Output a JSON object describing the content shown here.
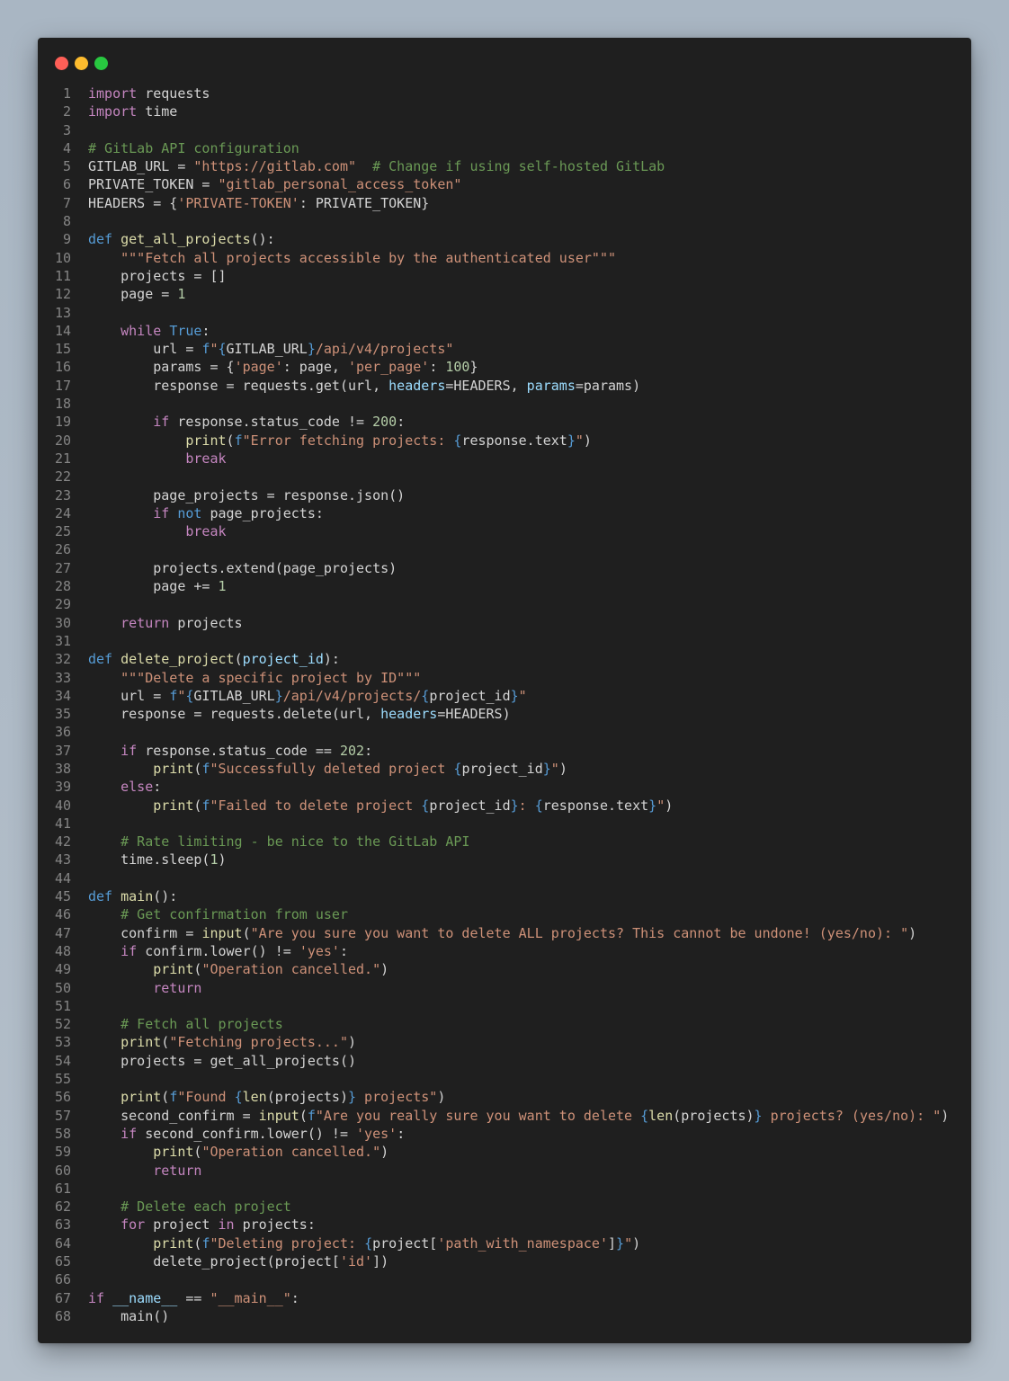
{
  "window": {
    "controls": [
      {
        "name": "close",
        "color": "#ff5f57"
      },
      {
        "name": "minimize",
        "color": "#febc2e"
      },
      {
        "name": "maximize",
        "color": "#28c840"
      }
    ]
  },
  "code": {
    "language": "python",
    "lines": [
      [
        [
          "kw",
          "import"
        ],
        [
          "tx",
          " requests"
        ]
      ],
      [
        [
          "kw",
          "import"
        ],
        [
          "tx",
          " time"
        ]
      ],
      [],
      [
        [
          "cm",
          "# GitLab API configuration"
        ]
      ],
      [
        [
          "tx",
          "GITLAB_URL = "
        ],
        [
          "str",
          "\"https://gitlab.com\""
        ],
        [
          "tx",
          "  "
        ],
        [
          "cm",
          "# Change if using self-hosted GitLab"
        ]
      ],
      [
        [
          "tx",
          "PRIVATE_TOKEN = "
        ],
        [
          "str",
          "\"gitlab_personal_access_token\""
        ]
      ],
      [
        [
          "tx",
          "HEADERS = {"
        ],
        [
          "str",
          "'PRIVATE-TOKEN'"
        ],
        [
          "tx",
          ": PRIVATE_TOKEN}"
        ]
      ],
      [],
      [
        [
          "dk",
          "def"
        ],
        [
          "tx",
          " "
        ],
        [
          "fn",
          "get_all_projects"
        ],
        [
          "tx",
          "():"
        ]
      ],
      [
        [
          "tx",
          "    "
        ],
        [
          "str",
          "\"\"\"Fetch all projects accessible by the authenticated user\"\"\""
        ]
      ],
      [
        [
          "tx",
          "    projects = []"
        ]
      ],
      [
        [
          "tx",
          "    page = "
        ],
        [
          "num",
          "1"
        ]
      ],
      [],
      [
        [
          "tx",
          "    "
        ],
        [
          "kw",
          "while"
        ],
        [
          "tx",
          " "
        ],
        [
          "dk",
          "True"
        ],
        [
          "tx",
          ":"
        ]
      ],
      [
        [
          "tx",
          "        url = "
        ],
        [
          "dk",
          "f"
        ],
        [
          "str",
          "\""
        ],
        [
          "br",
          "{"
        ],
        [
          "tx",
          "GITLAB_URL"
        ],
        [
          "br",
          "}"
        ],
        [
          "str",
          "/api/v4/projects\""
        ]
      ],
      [
        [
          "tx",
          "        params = {"
        ],
        [
          "str",
          "'page'"
        ],
        [
          "tx",
          ": page, "
        ],
        [
          "str",
          "'per_page'"
        ],
        [
          "tx",
          ": "
        ],
        [
          "num",
          "100"
        ],
        [
          "tx",
          "}"
        ]
      ],
      [
        [
          "tx",
          "        response = requests.get(url, "
        ],
        [
          "prm",
          "headers"
        ],
        [
          "tx",
          "=HEADERS, "
        ],
        [
          "prm",
          "params"
        ],
        [
          "tx",
          "=params)"
        ]
      ],
      [],
      [
        [
          "tx",
          "        "
        ],
        [
          "kw",
          "if"
        ],
        [
          "tx",
          " response.status_code != "
        ],
        [
          "num",
          "200"
        ],
        [
          "tx",
          ":"
        ]
      ],
      [
        [
          "tx",
          "            "
        ],
        [
          "fn",
          "print"
        ],
        [
          "tx",
          "("
        ],
        [
          "dk",
          "f"
        ],
        [
          "str",
          "\"Error fetching projects: "
        ],
        [
          "br",
          "{"
        ],
        [
          "tx",
          "response.text"
        ],
        [
          "br",
          "}"
        ],
        [
          "str",
          "\""
        ],
        [
          "tx",
          ")"
        ]
      ],
      [
        [
          "tx",
          "            "
        ],
        [
          "kw",
          "break"
        ]
      ],
      [],
      [
        [
          "tx",
          "        page_projects = response.json()"
        ]
      ],
      [
        [
          "tx",
          "        "
        ],
        [
          "kw",
          "if"
        ],
        [
          "tx",
          " "
        ],
        [
          "dk",
          "not"
        ],
        [
          "tx",
          " page_projects:"
        ]
      ],
      [
        [
          "tx",
          "            "
        ],
        [
          "kw",
          "break"
        ]
      ],
      [],
      [
        [
          "tx",
          "        projects.extend(page_projects)"
        ]
      ],
      [
        [
          "tx",
          "        page += "
        ],
        [
          "num",
          "1"
        ]
      ],
      [],
      [
        [
          "tx",
          "    "
        ],
        [
          "kw",
          "return"
        ],
        [
          "tx",
          " projects"
        ]
      ],
      [],
      [
        [
          "dk",
          "def"
        ],
        [
          "tx",
          " "
        ],
        [
          "fn",
          "delete_project"
        ],
        [
          "tx",
          "("
        ],
        [
          "prm",
          "project_id"
        ],
        [
          "tx",
          "):"
        ]
      ],
      [
        [
          "tx",
          "    "
        ],
        [
          "str",
          "\"\"\"Delete a specific project by ID\"\"\""
        ]
      ],
      [
        [
          "tx",
          "    url = "
        ],
        [
          "dk",
          "f"
        ],
        [
          "str",
          "\""
        ],
        [
          "br",
          "{"
        ],
        [
          "tx",
          "GITLAB_URL"
        ],
        [
          "br",
          "}"
        ],
        [
          "str",
          "/api/v4/projects/"
        ],
        [
          "br",
          "{"
        ],
        [
          "tx",
          "project_id"
        ],
        [
          "br",
          "}"
        ],
        [
          "str",
          "\""
        ]
      ],
      [
        [
          "tx",
          "    response = requests.delete(url, "
        ],
        [
          "prm",
          "headers"
        ],
        [
          "tx",
          "=HEADERS)"
        ]
      ],
      [],
      [
        [
          "tx",
          "    "
        ],
        [
          "kw",
          "if"
        ],
        [
          "tx",
          " response.status_code == "
        ],
        [
          "num",
          "202"
        ],
        [
          "tx",
          ":"
        ]
      ],
      [
        [
          "tx",
          "        "
        ],
        [
          "fn",
          "print"
        ],
        [
          "tx",
          "("
        ],
        [
          "dk",
          "f"
        ],
        [
          "str",
          "\"Successfully deleted project "
        ],
        [
          "br",
          "{"
        ],
        [
          "tx",
          "project_id"
        ],
        [
          "br",
          "}"
        ],
        [
          "str",
          "\""
        ],
        [
          "tx",
          ")"
        ]
      ],
      [
        [
          "tx",
          "    "
        ],
        [
          "kw",
          "else"
        ],
        [
          "tx",
          ":"
        ]
      ],
      [
        [
          "tx",
          "        "
        ],
        [
          "fn",
          "print"
        ],
        [
          "tx",
          "("
        ],
        [
          "dk",
          "f"
        ],
        [
          "str",
          "\"Failed to delete project "
        ],
        [
          "br",
          "{"
        ],
        [
          "tx",
          "project_id"
        ],
        [
          "br",
          "}"
        ],
        [
          "str",
          ": "
        ],
        [
          "br",
          "{"
        ],
        [
          "tx",
          "response.text"
        ],
        [
          "br",
          "}"
        ],
        [
          "str",
          "\""
        ],
        [
          "tx",
          ")"
        ]
      ],
      [],
      [
        [
          "tx",
          "    "
        ],
        [
          "cm",
          "# Rate limiting - be nice to the GitLab API"
        ]
      ],
      [
        [
          "tx",
          "    time.sleep("
        ],
        [
          "num",
          "1"
        ],
        [
          "tx",
          ")"
        ]
      ],
      [],
      [
        [
          "dk",
          "def"
        ],
        [
          "tx",
          " "
        ],
        [
          "fn",
          "main"
        ],
        [
          "tx",
          "():"
        ]
      ],
      [
        [
          "tx",
          "    "
        ],
        [
          "cm",
          "# Get confirmation from user"
        ]
      ],
      [
        [
          "tx",
          "    confirm = "
        ],
        [
          "fn",
          "input"
        ],
        [
          "tx",
          "("
        ],
        [
          "str",
          "\"Are you sure you want to delete ALL projects? This cannot be undone! (yes/no): \""
        ],
        [
          "tx",
          ")"
        ]
      ],
      [
        [
          "tx",
          "    "
        ],
        [
          "kw",
          "if"
        ],
        [
          "tx",
          " confirm.lower() != "
        ],
        [
          "str",
          "'yes'"
        ],
        [
          "tx",
          ":"
        ]
      ],
      [
        [
          "tx",
          "        "
        ],
        [
          "fn",
          "print"
        ],
        [
          "tx",
          "("
        ],
        [
          "str",
          "\"Operation cancelled.\""
        ],
        [
          "tx",
          ")"
        ]
      ],
      [
        [
          "tx",
          "        "
        ],
        [
          "kw",
          "return"
        ]
      ],
      [],
      [
        [
          "tx",
          "    "
        ],
        [
          "cm",
          "# Fetch all projects"
        ]
      ],
      [
        [
          "tx",
          "    "
        ],
        [
          "fn",
          "print"
        ],
        [
          "tx",
          "("
        ],
        [
          "str",
          "\"Fetching projects...\""
        ],
        [
          "tx",
          ")"
        ]
      ],
      [
        [
          "tx",
          "    projects = get_all_projects()"
        ]
      ],
      [],
      [
        [
          "tx",
          "    "
        ],
        [
          "fn",
          "print"
        ],
        [
          "tx",
          "("
        ],
        [
          "dk",
          "f"
        ],
        [
          "str",
          "\"Found "
        ],
        [
          "br",
          "{"
        ],
        [
          "fn",
          "len"
        ],
        [
          "tx",
          "(projects)"
        ],
        [
          "br",
          "}"
        ],
        [
          "str",
          " projects\""
        ],
        [
          "tx",
          ")"
        ]
      ],
      [
        [
          "tx",
          "    second_confirm = "
        ],
        [
          "fn",
          "input"
        ],
        [
          "tx",
          "("
        ],
        [
          "dk",
          "f"
        ],
        [
          "str",
          "\"Are you really sure you want to delete "
        ],
        [
          "br",
          "{"
        ],
        [
          "fn",
          "len"
        ],
        [
          "tx",
          "(projects)"
        ],
        [
          "br",
          "}"
        ],
        [
          "str",
          " projects? (yes/no): \""
        ],
        [
          "tx",
          ")"
        ]
      ],
      [
        [
          "tx",
          "    "
        ],
        [
          "kw",
          "if"
        ],
        [
          "tx",
          " second_confirm.lower() != "
        ],
        [
          "str",
          "'yes'"
        ],
        [
          "tx",
          ":"
        ]
      ],
      [
        [
          "tx",
          "        "
        ],
        [
          "fn",
          "print"
        ],
        [
          "tx",
          "("
        ],
        [
          "str",
          "\"Operation cancelled.\""
        ],
        [
          "tx",
          ")"
        ]
      ],
      [
        [
          "tx",
          "        "
        ],
        [
          "kw",
          "return"
        ]
      ],
      [],
      [
        [
          "tx",
          "    "
        ],
        [
          "cm",
          "# Delete each project"
        ]
      ],
      [
        [
          "tx",
          "    "
        ],
        [
          "kw",
          "for"
        ],
        [
          "tx",
          " project "
        ],
        [
          "kw",
          "in"
        ],
        [
          "tx",
          " projects:"
        ]
      ],
      [
        [
          "tx",
          "        "
        ],
        [
          "fn",
          "print"
        ],
        [
          "tx",
          "("
        ],
        [
          "dk",
          "f"
        ],
        [
          "str",
          "\"Deleting project: "
        ],
        [
          "br",
          "{"
        ],
        [
          "tx",
          "project["
        ],
        [
          "str",
          "'path_with_namespace'"
        ],
        [
          "tx",
          "]"
        ],
        [
          "br",
          "}"
        ],
        [
          "str",
          "\""
        ],
        [
          "tx",
          ")"
        ]
      ],
      [
        [
          "tx",
          "        delete_project(project["
        ],
        [
          "str",
          "'id'"
        ],
        [
          "tx",
          "])"
        ]
      ],
      [],
      [
        [
          "kw",
          "if"
        ],
        [
          "tx",
          " "
        ],
        [
          "prm",
          "__name__"
        ],
        [
          "tx",
          " == "
        ],
        [
          "str",
          "\"__main__\""
        ],
        [
          "tx",
          ":"
        ]
      ],
      [
        [
          "tx",
          "    main()"
        ]
      ]
    ]
  }
}
